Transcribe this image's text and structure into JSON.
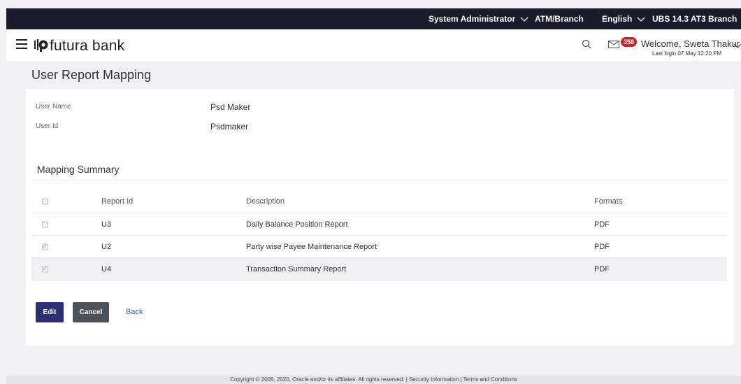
{
  "topbar": {
    "role": "System Administrator",
    "atm_branch": "ATM/Branch",
    "language": "English",
    "branch": "UBS 14.3 AT3 Branch"
  },
  "header": {
    "brand": "futura bank",
    "notifications_count": "358",
    "welcome": "Welcome, Sweta Thakur",
    "last_login": "Last login 07 May 12:20 PM"
  },
  "page": {
    "title": "User Report Mapping"
  },
  "user_info": {
    "user_name_label": "User Name",
    "user_name_value": "Psd Maker",
    "user_id_label": "User Id",
    "user_id_value": "Psdmaker"
  },
  "mapping": {
    "title": "Mapping Summary",
    "columns": {
      "report_id": "Report Id",
      "description": "Description",
      "formats": "Formats"
    },
    "rows": [
      {
        "report_id": "U3",
        "description": "Daily Balance Position Report",
        "format": "PDF",
        "checked": false
      },
      {
        "report_id": "U2",
        "description": "Party wise Payee Maintenance Report",
        "format": "PDF",
        "checked": true
      },
      {
        "report_id": "U4",
        "description": "Transaction Summary Report",
        "format": "PDF",
        "checked": true
      }
    ]
  },
  "actions": {
    "edit": "Edit",
    "cancel": "Cancel",
    "back": "Back"
  },
  "footer": {
    "text": "Copyright © 2006, 2020, Oracle and/or its affiliates. All rights reserved. | Security Information | Terms and Conditions"
  },
  "icons": {
    "menu": "hamburger-icon",
    "search": "search-icon",
    "mail": "mail-icon",
    "chevron": "chevron-down-icon",
    "logo": "futura-logo-icon"
  },
  "colors": {
    "topbar": "#1b1b2e",
    "primary_button": "#2d2e74",
    "secondary_button": "#4d5258",
    "badge": "#c6252b",
    "link": "#4b59a7"
  }
}
